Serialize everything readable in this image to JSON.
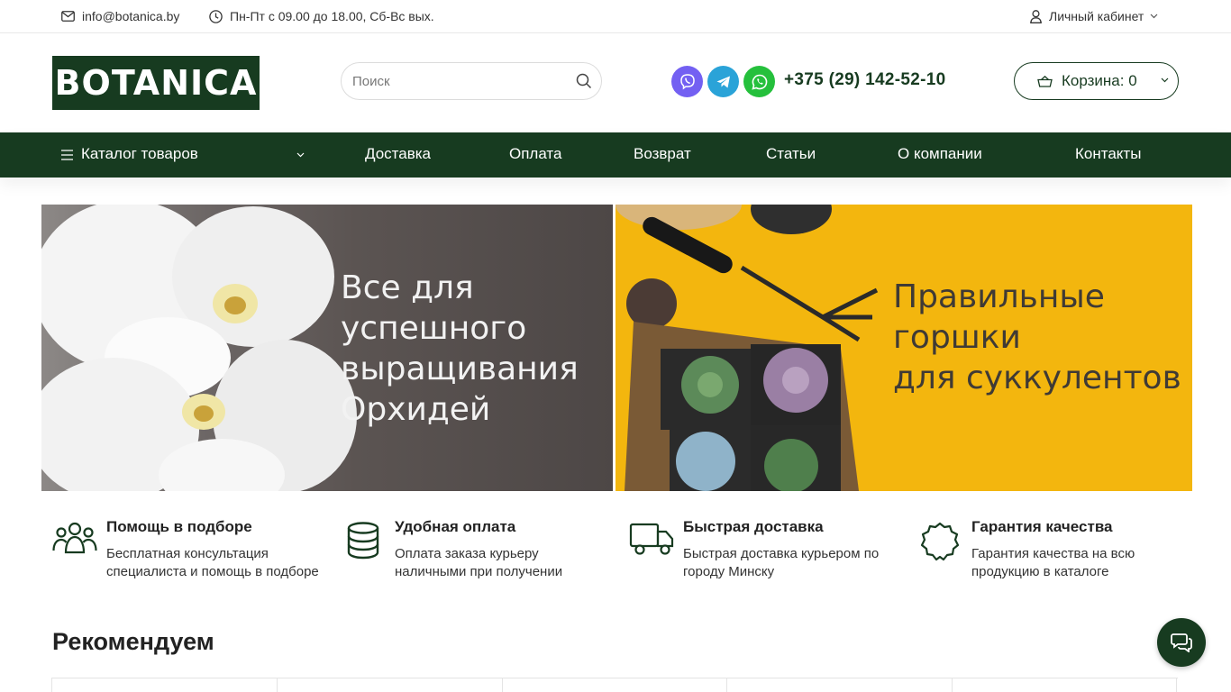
{
  "topbar": {
    "email": "info@botanica.by",
    "hours": "Пн-Пт с 09.00 до 18.00, Сб-Вс вых.",
    "account": "Личный кабинет"
  },
  "header": {
    "logo_text": "BOTANICA",
    "search_placeholder": "Поиск",
    "phone": "+375 (29) 142-52-10",
    "cart_label": "Корзина: 0",
    "messengers": [
      "viber-icon",
      "telegram-icon",
      "whatsapp-icon"
    ]
  },
  "nav": {
    "catalog": "Каталог товаров",
    "items": [
      "Доставка",
      "Оплата",
      "Возврат",
      "Статьи",
      "О компании",
      "Контакты"
    ]
  },
  "banners": [
    {
      "lines": [
        "Все для",
        "успешного",
        "выращивания",
        "Орхидей"
      ]
    },
    {
      "lines": [
        "Правильные",
        "горшки",
        "для суккулентов"
      ]
    }
  ],
  "features": [
    {
      "icon": "people-icon",
      "title": "Помощь в подборе",
      "desc": "Бесплатная консультация специалиста и помощь в подборе"
    },
    {
      "icon": "coins-icon",
      "title": "Удобная оплата",
      "desc": "Оплата заказа курьеру наличными при получении"
    },
    {
      "icon": "truck-icon",
      "title": "Быстрая доставка",
      "desc": "Быстрая доставка курьером по городу Минску"
    },
    {
      "icon": "quality-badge-icon",
      "title": "Гарантия качества",
      "desc": "Гарантия качества на всю продукцию в каталоге"
    }
  ],
  "recommend_title": "Рекомендуем",
  "colors": {
    "brand_green": "#173b20",
    "banner_yellow": "#f3b60e",
    "viber": "#7360f2",
    "telegram": "#2aa3d8",
    "whatsapp": "#25c03c"
  }
}
